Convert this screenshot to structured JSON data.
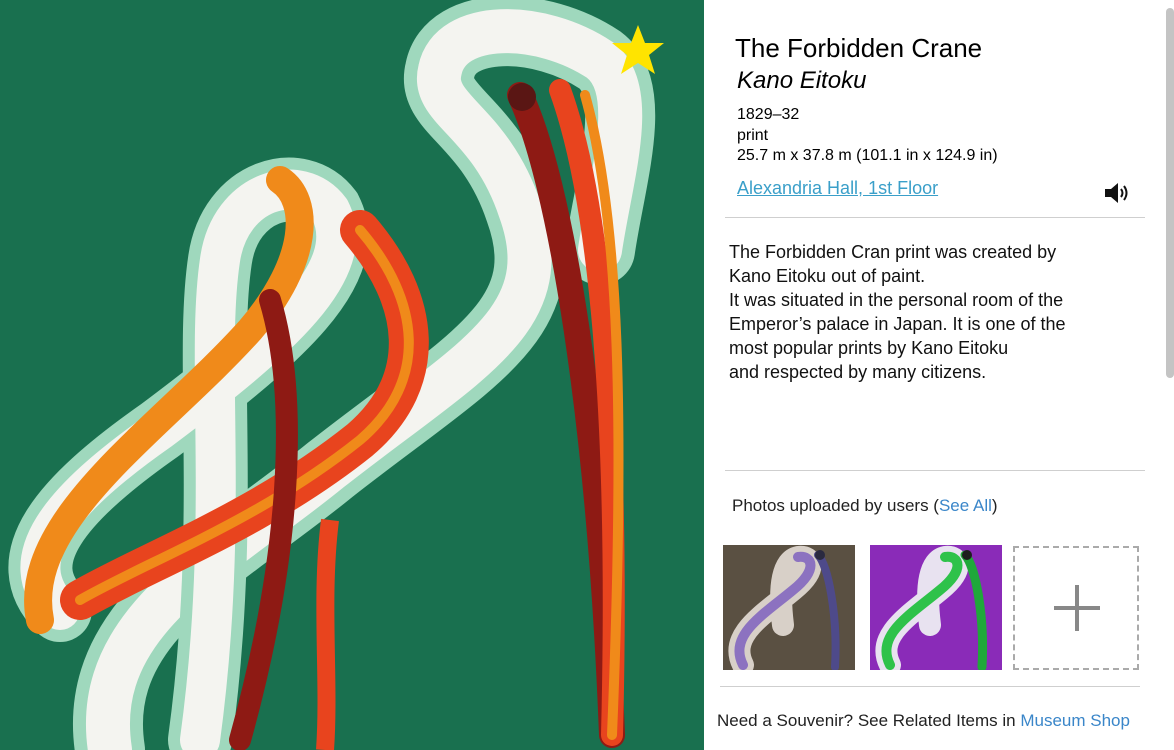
{
  "artwork": {
    "title": "The Forbidden Crane",
    "artist": "Kano Eitoku",
    "date": "1829–32",
    "medium": "print",
    "dimensions": "25.7 m x 37.8 m (101.1 in x 124.9 in)",
    "location": "Alexandria Hall, 1st Floor",
    "favorite_icon": "star-icon",
    "audio_icon": "speaker-icon",
    "colors": {
      "background": "#19704f",
      "mint": "#9fd8bd",
      "white": "#f4f4f0",
      "orange": "#f08a1a",
      "red": "#e8441e",
      "dark_red": "#8e1a14",
      "star": "#ffe400"
    }
  },
  "description": {
    "line1": "The Forbidden Cran print was created by",
    "line2": "Kano Eitoku out of paint.",
    "line3": "It was situated in the personal room of the",
    "line4": "Emperor’s palace in Japan. It is one of the",
    "line5": "most popular prints by Kano Eitoku",
    "line6": "and respected by many citizens."
  },
  "photos": {
    "label": "Photos uploaded by users (",
    "see_all": "See All",
    "label_end": ")",
    "add_icon": "plus-icon"
  },
  "footer": {
    "text": "Need a Souvenir? See Related Items in ",
    "shop_link": "Museum Shop"
  }
}
